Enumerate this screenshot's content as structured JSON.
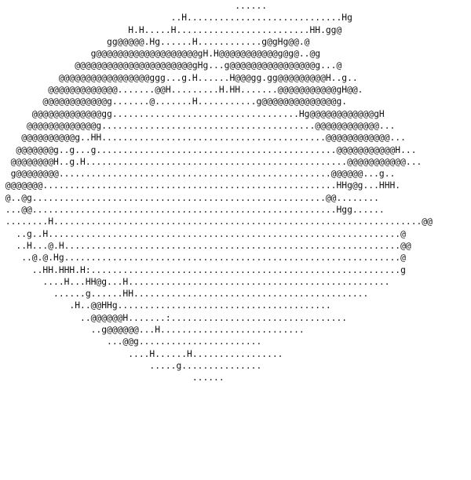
{
  "ascii_art": {
    "ink_color": "#111111",
    "background_color": "#ffffff",
    "lines": [
      "                                            ......                                            ",
      "                                ..H.............................Hg                              ",
      "                        H.H.....H.........................HH.gg@                        ",
      "                    gg@@@@@.Hg......H............g@gHg@@.@                    ",
      "                 g@@@@@@@@@@@@@@@@@@@gH.H@@@@@@@@@@@g@g@..@g                 ",
      "              @@@@@@@@@@@@@@@@@@@@@@gHg...g@@@@@@@@@@@@@@@@g...@              ",
      "           @@@@@@@@@@@@@@@@@ggg...g.H......H@@@gg.gg@@@@@@@@@H..g..           ",
      "         @@@@@@@@@@@@@.......@@H.........H.HH.......@@@@@@@@@@@gH@@.         ",
      "        @@@@@@@@@@@@g.......@.......H...........g@@@@@@@@@@@@@@g.        ",
      "      @@@@@@@@@@@@@gg...................................Hg@@@@@@@@@@@@gH      ",
      "     @@@@@@@@@@@@@g........................................@@@@@@@@@@@@...     ",
      "    @@@@@@@@@@g..HH..........................................@@@@@@@@@@@@...    ",
      "   @@@@@@@g..g...g.............................................@@@@@@@@@@@H...   ",
      "  @@@@@@@@H..g.H.................................................@@@@@@@@@@@...  ",
      "  g@@@@@@@@...................................................@@@@@@...g.. ",
      " @@@@@@@.......................................................HHg@g...HHH. ",
      " @..@g.......................................................@@........ ",
      " ...@@.........................................................Hgg...... ",
      " ........H.....................................................................@@ ",
      "   ..g..H..................................................................@ ",
      "   ..H...@.H...............................................................@@ ",
      "    ..@.@.Hg...............................................................@  ",
      "      ..HH.HHH.H:..........................................................g   ",
      "        ....H...HH@g...H.................................................     ",
      "          ......g......HH............................................         ",
      "             .H..@@HHg........................................           ",
      "               ..@@@@@@H.......:.................................           ",
      "                 ..g@@@@@@...H...........................                 ",
      "                    ...@@g.......................                    ",
      "                        ....H......H.................                        ",
      "                            .....g...............                            ",
      "                                    ......                                    "
    ]
  }
}
